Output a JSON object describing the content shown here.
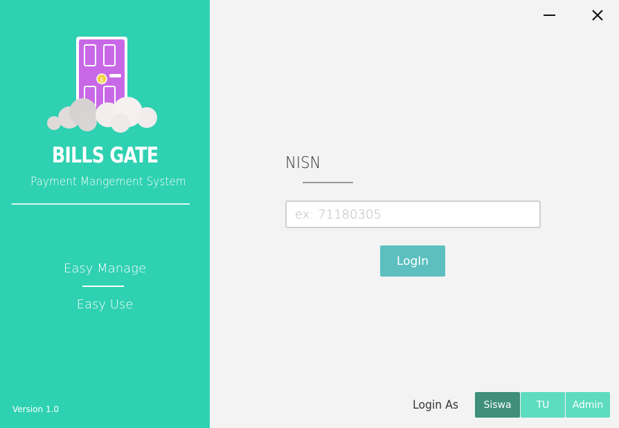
{
  "sidebar": {
    "brand": "BILLS GATE",
    "tagline": "Payment Mangement System",
    "features": [
      "Easy Manage",
      "Easy Use"
    ],
    "version": "Version 1.0",
    "logo_icon": "door-on-cloud-icon",
    "bg_color": "#2ed1b1"
  },
  "window": {
    "minimize_icon": "minimize-icon",
    "close_icon": "close-icon"
  },
  "form": {
    "label": "NISN",
    "input_placeholder": "ex: 71180305",
    "input_value": "",
    "login_label": "LogIn"
  },
  "roles": {
    "title": "Login As",
    "options": [
      "Siswa",
      "TU",
      "Admin"
    ],
    "selected": "Siswa"
  }
}
